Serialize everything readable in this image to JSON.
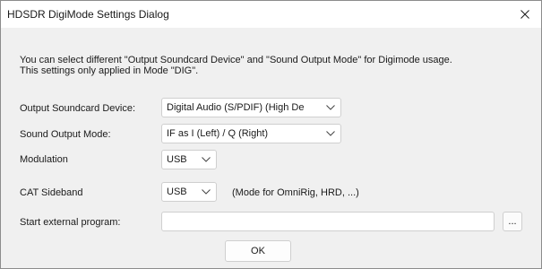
{
  "window": {
    "title": "HDSDR DigiMode Settings Dialog",
    "close_glyph": "close-icon"
  },
  "description": {
    "line1": "You can select different \"Output Soundcard Device\" and \"Sound Output Mode\" for Digimode usage.",
    "line2": "This settings only applied in Mode \"DIG\"."
  },
  "fields": {
    "output_device": {
      "label": "Output Soundcard Device:",
      "value": "Digital Audio (S/PDIF) (High De"
    },
    "output_mode": {
      "label": "Sound Output Mode:",
      "value": "IF as I (Left) / Q (Right)"
    },
    "modulation": {
      "label": "Modulation",
      "value": "USB"
    },
    "cat_sideband": {
      "label": "CAT Sideband",
      "value": "USB",
      "hint": "(Mode for OmniRig, HRD, ...)"
    },
    "external_program": {
      "label": "Start external program:",
      "value": "",
      "browse_label": "..."
    }
  },
  "buttons": {
    "ok_label": "OK"
  }
}
